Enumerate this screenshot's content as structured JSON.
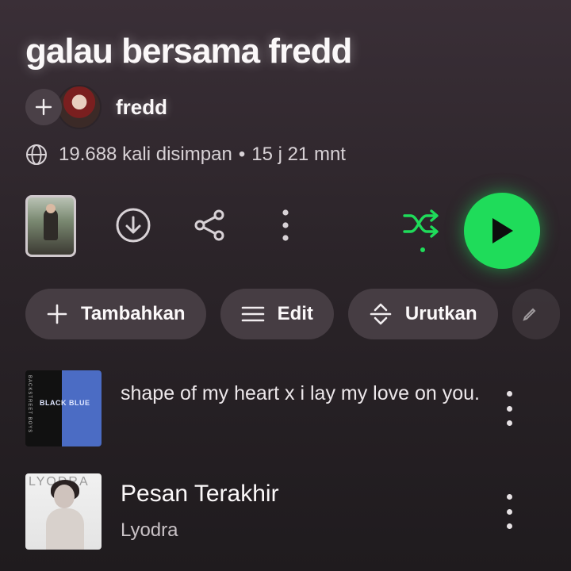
{
  "playlist": {
    "title": "galau bersama fredd",
    "owner": "fredd",
    "saves_text": "19.688 kali disimpan",
    "separator": "•",
    "duration_text": "15 j 21 mnt"
  },
  "icons": {
    "add_owner": "plus-icon",
    "globe": "globe-icon",
    "download": "download-icon",
    "share": "share-icon",
    "more": "more-vertical-icon",
    "shuffle": "shuffle-icon",
    "play": "play-icon"
  },
  "colors": {
    "accent_green": "#1fdc5a",
    "background": "#2b2429",
    "pill_bg": "#463d43"
  },
  "actions": [
    {
      "label": "Tambahkan",
      "icon": "plus-icon"
    },
    {
      "label": "Edit",
      "icon": "menu-lines-icon"
    },
    {
      "label": "Urutkan",
      "icon": "sort-icon"
    }
  ],
  "tracks": [
    {
      "title": "shape of my heart x i lay my love on you.",
      "artist": "",
      "art_text": "BLACK BLUE",
      "art_side_text": "BACKSTREET BOYS"
    },
    {
      "title": "Pesan Terakhir",
      "artist": "Lyodra",
      "art_text": "LYODRA"
    }
  ]
}
